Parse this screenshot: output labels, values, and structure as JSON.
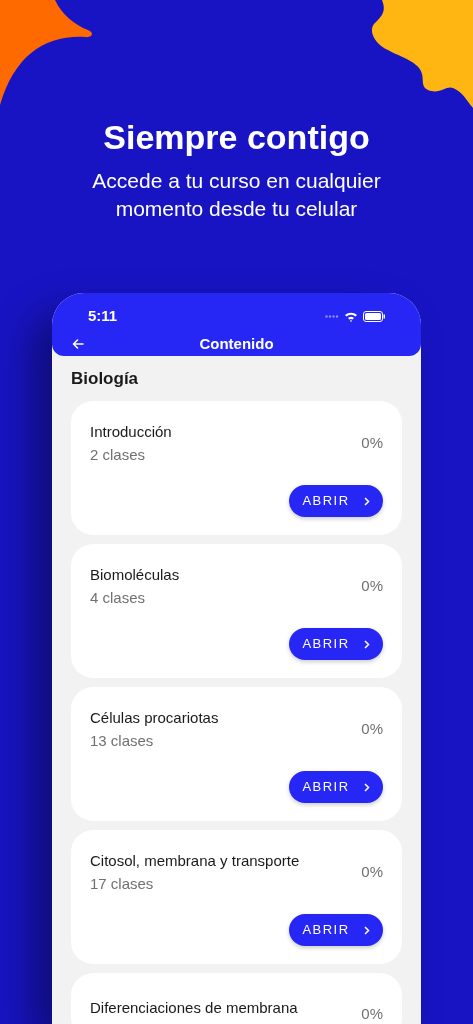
{
  "headline": "Siempre contigo",
  "subtitle": "Accede a tu curso en cualquier momento desde tu celular",
  "phone": {
    "time": "5:11",
    "nav_title": "Contenido",
    "section": "Biología",
    "cards": [
      {
        "title": "Introducción",
        "count": "2 clases",
        "percent": "0%",
        "button": "ABRIR"
      },
      {
        "title": "Biomoléculas",
        "count": "4 clases",
        "percent": "0%",
        "button": "ABRIR"
      },
      {
        "title": "Células procariotas",
        "count": "13 clases",
        "percent": "0%",
        "button": "ABRIR"
      },
      {
        "title": "Citosol, membrana y transporte",
        "count": "17 clases",
        "percent": "0%",
        "button": "ABRIR"
      },
      {
        "title": "Diferenciaciones de membrana",
        "percent": "0%"
      }
    ]
  }
}
